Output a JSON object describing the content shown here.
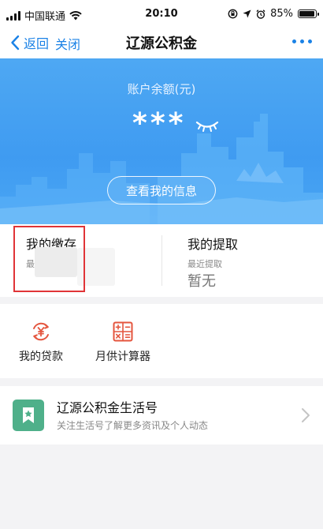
{
  "status_bar": {
    "carrier": "中国联通",
    "time": "20:10",
    "battery_percent": "85%",
    "battery_level": 0.85,
    "icons": [
      "signal-bars-icon",
      "wifi-icon",
      "orientation-lock-icon",
      "location-arrow-icon",
      "alarm-icon",
      "battery-icon"
    ]
  },
  "nav": {
    "back_label": "返回",
    "close_label": "关闭",
    "title": "辽源公积金",
    "more_icon": "more-dots-icon"
  },
  "account": {
    "balance_label": "账户余额(元)",
    "balance_value": "***",
    "view_info_button": "查看我的信息",
    "eye_icon": "eye-closed-icon"
  },
  "deposit": {
    "title": "我的缴存",
    "sub_label_partial": "最"
  },
  "withdraw": {
    "title": "我的提取",
    "sub_label": "最近提取",
    "value": "暂无"
  },
  "tools": [
    {
      "label": "我的贷款",
      "icon": "yuan-cycle-icon"
    },
    {
      "label": "月供计算器",
      "icon": "calculator-icon"
    }
  ],
  "service": {
    "title": "辽源公积金生活号",
    "description": "关注生活号了解更多资讯及个人动态",
    "icon": "bookmark-star-icon"
  },
  "colors": {
    "accent": "#1b82e6",
    "hero_blue": "#3f9bf1",
    "tool_icon_red": "#e4553e",
    "highlight_red": "#e03437",
    "service_green": "#4fb08a"
  }
}
